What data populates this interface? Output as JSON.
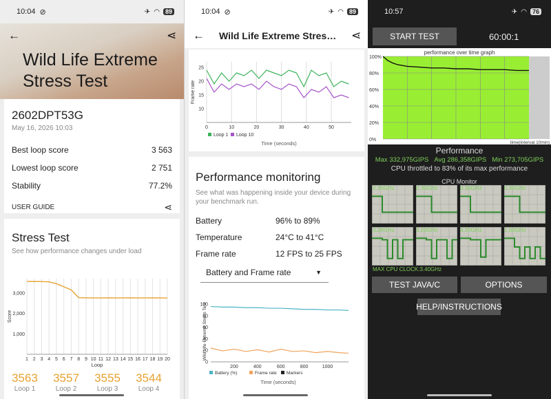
{
  "panel1": {
    "status": {
      "time": "10:04",
      "battery": "89"
    },
    "hero_title": "Wild Life Extreme Stress Test",
    "hero_title_line1": "Wild Life Extreme",
    "hero_title_line2": "Stress Test",
    "device": "2602DPT53G",
    "date": "May 16, 2026 10:03",
    "stats": [
      {
        "label": "Best loop score",
        "value": "3 563"
      },
      {
        "label": "Lowest loop score",
        "value": "2 751"
      },
      {
        "label": "Stability",
        "value": "77.2%"
      }
    ],
    "user_guide": "USER GUIDE",
    "stress_title": "Stress Test",
    "stress_sub": "See how performance changes under load",
    "loops": [
      {
        "score": "3563",
        "label": "Loop 1"
      },
      {
        "score": "3557",
        "label": "Loop 2"
      },
      {
        "score": "3555",
        "label": "Loop 3"
      },
      {
        "score": "3544",
        "label": "Loop 4"
      }
    ]
  },
  "panel2": {
    "status": {
      "time": "10:04",
      "battery": "89"
    },
    "title": "Wild Life Extreme Stress...",
    "pm_title": "Performance monitoring",
    "pm_sub": "See what was happening inside your device during your benchmark run.",
    "metrics": [
      {
        "label": "Battery",
        "value": "96% to 89%"
      },
      {
        "label": "Temperature",
        "value": "24°C to 41°C"
      },
      {
        "label": "Frame rate",
        "value": "12 FPS to 25 FPS"
      }
    ],
    "select_value": "Battery and Frame rate",
    "legend_markers": "Markers"
  },
  "panel3": {
    "status": {
      "time": "10:57",
      "battery": "76"
    },
    "start_test": "START TEST",
    "timer": "60:00:1",
    "graph_title": "performance over time graph",
    "graph_x_label": "time(interval 10min)",
    "performance_title": "Performance",
    "perf_max": "Max 332,975GIPS",
    "perf_avg": "Avg 286,358GIPS",
    "perf_min": "Min 273,705GIPS",
    "throttle_note": "CPU throttled to 83% of its max performance",
    "cpu_monitor": "CPU Monitor",
    "cpu_top_clocks": [
      "0.30GHz",
      "0.30GHz",
      "0.30GHz",
      "0.30GHz"
    ],
    "cpu_bottom_clocks": [
      "3.20GHz",
      "3.20GHz",
      "3.20GHz",
      "1.00GHz"
    ],
    "max_cpu_clock": "MAX CPU CLOCK:3.40GHz",
    "btn_java": "TEST JAVA/C",
    "btn_options": "OPTIONS",
    "btn_help": "HELP/INSTRUCTIONS",
    "colors": {
      "graph_green": "#99ee33",
      "accent_text": "#7fd05a"
    }
  },
  "chart_data": [
    {
      "type": "line",
      "title": "",
      "xlabel": "Time (seconds)",
      "ylabel": "Frame rate",
      "xlim": [
        0,
        58
      ],
      "ylim": [
        5,
        27
      ],
      "x_ticks": [
        0,
        10,
        20,
        30,
        40,
        50
      ],
      "y_ticks": [
        10,
        15,
        20,
        25
      ],
      "x": [
        0,
        3,
        6,
        9,
        12,
        15,
        18,
        21,
        24,
        27,
        30,
        33,
        36,
        39,
        42,
        45,
        48,
        51,
        54,
        57
      ],
      "series": [
        {
          "name": "Loop 1",
          "color": "#3cb35a",
          "values": [
            24,
            19,
            23,
            20,
            23,
            22,
            24,
            21,
            24,
            23,
            22,
            24,
            23,
            18,
            24,
            22,
            23,
            18,
            20,
            19
          ]
        },
        {
          "name": "Loop 10",
          "color": "#a453c8",
          "values": [
            21,
            16,
            19,
            17,
            19,
            18,
            19,
            17,
            20,
            18,
            17,
            19,
            18,
            14,
            17,
            16,
            18,
            14,
            15,
            14
          ]
        }
      ]
    },
    {
      "type": "bar",
      "title": "",
      "xlabel": "Loop",
      "ylabel": "Score",
      "categories": [
        "1",
        "2",
        "3",
        "4",
        "5",
        "6",
        "7",
        "8",
        "9",
        "10",
        "11",
        "12",
        "13",
        "14",
        "15",
        "16",
        "17",
        "18",
        "19",
        "20"
      ],
      "values": [
        3563,
        3557,
        3555,
        3544,
        3450,
        3300,
        3150,
        2770,
        2760,
        2755,
        2755,
        2760,
        2755,
        2760,
        2758,
        2756,
        2757,
        2760,
        2755,
        2751
      ],
      "ylim": [
        0,
        3700
      ],
      "y_ticks": [
        1000,
        2000,
        3000
      ]
    },
    {
      "type": "line",
      "title": "Wild Life Extreme Stress Test",
      "xlabel": "Time (seconds)",
      "xlim": [
        0,
        1180
      ],
      "ylim": [
        0,
        105
      ],
      "x_ticks": [
        200,
        400,
        600,
        800,
        1000
      ],
      "y_ticks": [
        0,
        20,
        40,
        60,
        80,
        100
      ],
      "x": [
        0,
        100,
        200,
        300,
        400,
        500,
        600,
        700,
        800,
        900,
        1000,
        1100,
        1180
      ],
      "series": [
        {
          "name": "Battery (%)",
          "color": "#4bb3c4",
          "values": [
            96,
            95,
            95,
            94,
            94,
            93,
            93,
            92,
            91,
            91,
            90,
            90,
            89
          ]
        },
        {
          "name": "Frame rate",
          "color": "#f0a25a",
          "values": [
            24,
            19,
            22,
            18,
            21,
            17,
            22,
            18,
            19,
            16,
            18,
            16,
            15
          ]
        }
      ]
    },
    {
      "type": "area",
      "title": "performance over time graph",
      "xlabel": "time(interval 10min)",
      "ylim": [
        0,
        100
      ],
      "y_ticks": [
        0,
        20,
        40,
        60,
        80,
        100
      ],
      "x": [
        0,
        2,
        4,
        6,
        8,
        10,
        15,
        20,
        25,
        30,
        35,
        40,
        45,
        50,
        55,
        60
      ],
      "values": [
        100,
        95,
        92,
        90,
        89,
        88,
        87,
        86,
        86,
        85,
        85,
        84,
        84,
        84,
        83,
        83
      ]
    }
  ]
}
